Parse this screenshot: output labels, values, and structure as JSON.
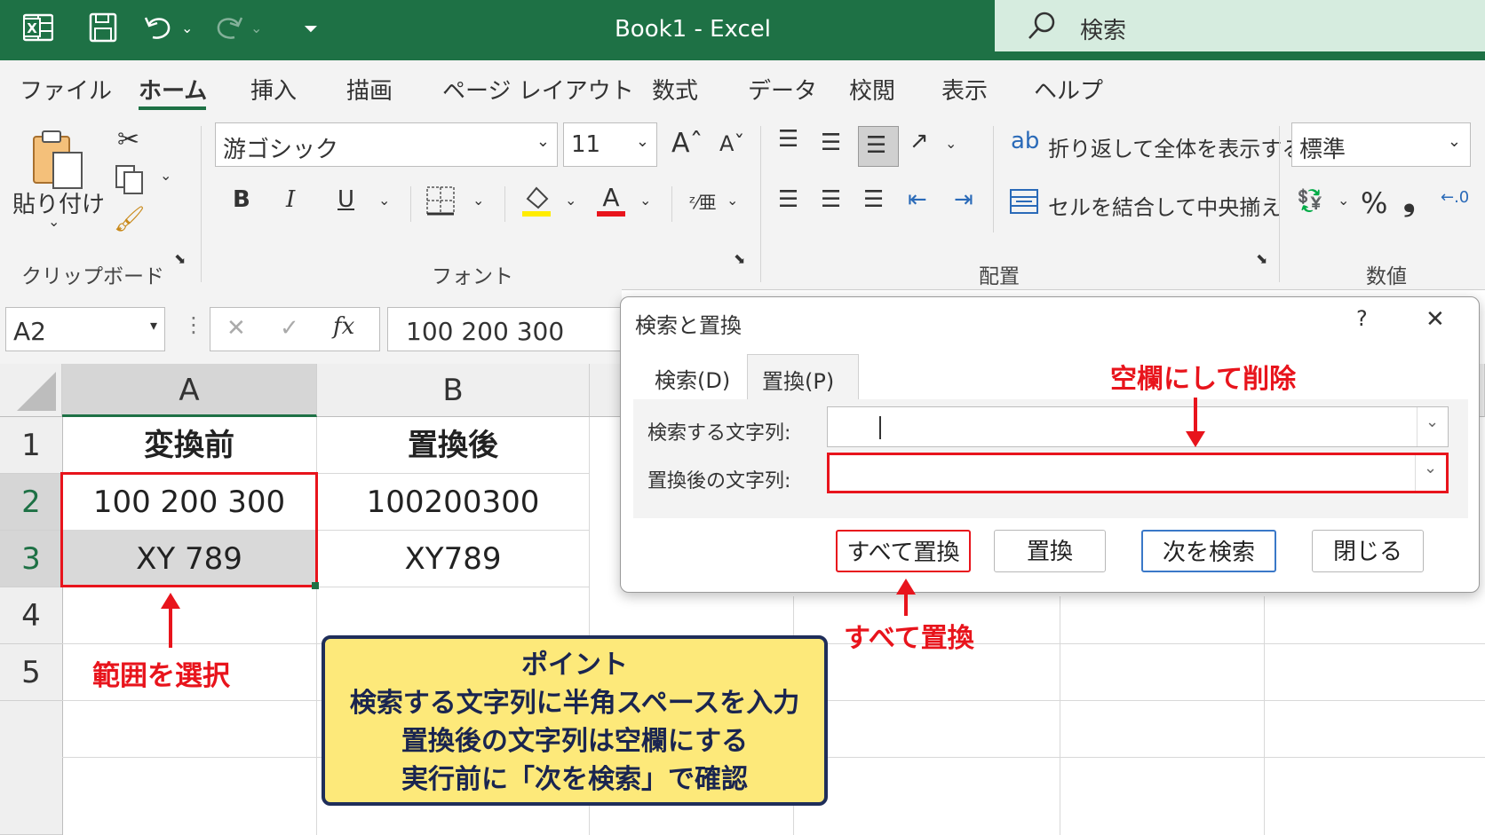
{
  "titlebar": {
    "title": "Book1  -  Excel",
    "search_label": "検索"
  },
  "menu": {
    "items": [
      "ファイル",
      "ホーム",
      "挿入",
      "描画",
      "ページ レイアウト",
      "数式",
      "データ",
      "校閲",
      "表示",
      "ヘルプ"
    ],
    "active": "ホーム"
  },
  "ribbon": {
    "paste_label": "貼り付け",
    "clipboard_group": "クリップボード",
    "font_name": "游ゴシック",
    "font_size": "11",
    "font_group": "フォント",
    "bold": "B",
    "italic": "I",
    "underline": "U",
    "wrap_text": "折り返して全体を表示する",
    "merge_center": "セルを結合して中央揃え",
    "alignment_group": "配置",
    "number_format": "標準",
    "number_group": "数値",
    "percent": "%",
    "comma": "❟"
  },
  "formula_bar": {
    "name_box": "A2",
    "fx": "fx",
    "content": "100 200 300"
  },
  "sheet": {
    "columns": [
      "A",
      "B"
    ],
    "rows": [
      "1",
      "2",
      "3",
      "4",
      "5"
    ],
    "cells": {
      "A1": "変換前",
      "B1": "置換後",
      "A2": "100 200 300",
      "B2": "100200300",
      "A3": "XY 789",
      "B3": "XY789"
    }
  },
  "dialog": {
    "title": "検索と置換",
    "help": "?",
    "close": "✕",
    "tab_find": "検索(D)",
    "tab_replace": "置換(P)",
    "find_label": "検索する文字列:",
    "find_value": " ",
    "replace_label": "置換後の文字列:",
    "replace_value": "",
    "btn_replace_all": "すべて置換",
    "btn_replace": "置換",
    "btn_find_next": "次を検索",
    "btn_close": "閉じる"
  },
  "annotations": {
    "blank_delete": "空欄にして削除",
    "replace_all": "すべて置換",
    "select_range": "範囲を選択",
    "point_lines": [
      "ポイント",
      "検索する文字列に半角スペースを入力",
      "置換後の文字列は空欄にする",
      "実行前に「次を検索」で確認"
    ]
  },
  "colors": {
    "excel_green": "#1e7145",
    "annotation_red": "#e8141c",
    "point_bg": "#fde97a",
    "point_border": "#1f2e5a"
  }
}
